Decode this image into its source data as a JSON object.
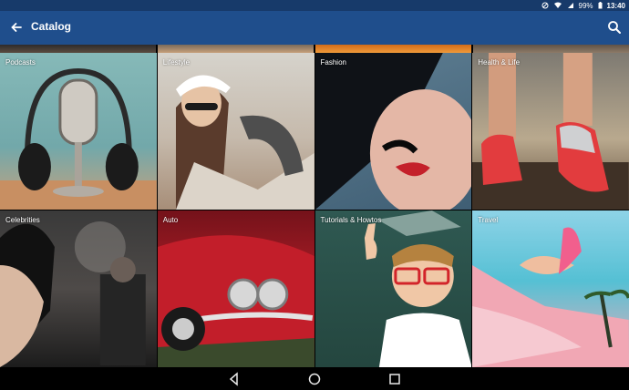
{
  "status": {
    "battery": "99%",
    "time": "13:40"
  },
  "appbar": {
    "title": "Catalog"
  },
  "tiles": [
    {
      "label": "Podcasts"
    },
    {
      "label": "Lifestyle"
    },
    {
      "label": "Fashion"
    },
    {
      "label": "Health & Life"
    },
    {
      "label": "Celebrities"
    },
    {
      "label": "Auto"
    },
    {
      "label": "Tutorials & Howtos"
    },
    {
      "label": "Travel"
    }
  ],
  "icons": {
    "back": "back-arrow-icon",
    "search": "search-icon",
    "nav_back": "nav-back-icon",
    "nav_home": "nav-home-icon",
    "nav_recents": "nav-recents-icon"
  },
  "colors": {
    "status_bar": "#173a6a",
    "app_bar": "#1f4e8c"
  }
}
